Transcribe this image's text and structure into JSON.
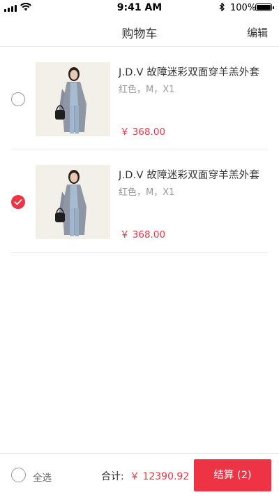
{
  "status_bar": {
    "time": "9:41 AM",
    "battery": "100%"
  },
  "nav": {
    "title": "购物车",
    "edit_label": "编辑"
  },
  "items": [
    {
      "title": "J.D.V 故障迷彩双面穿羊羔外套",
      "spec": "红色，M，X1",
      "price": "￥ 368.00",
      "selected": false
    },
    {
      "title": "J.D.V 故障迷彩双面穿羊羔外套",
      "spec": "红色，M，X1",
      "price": "￥ 368.00",
      "selected": true
    }
  ],
  "footer": {
    "select_all_label": "全选",
    "total_label": "合计:",
    "total_amount": "￥ 12390.92",
    "checkout_label": "结算 (2)"
  },
  "colors": {
    "accent": "#ee3344",
    "text": "#333333",
    "muted": "#999999"
  }
}
